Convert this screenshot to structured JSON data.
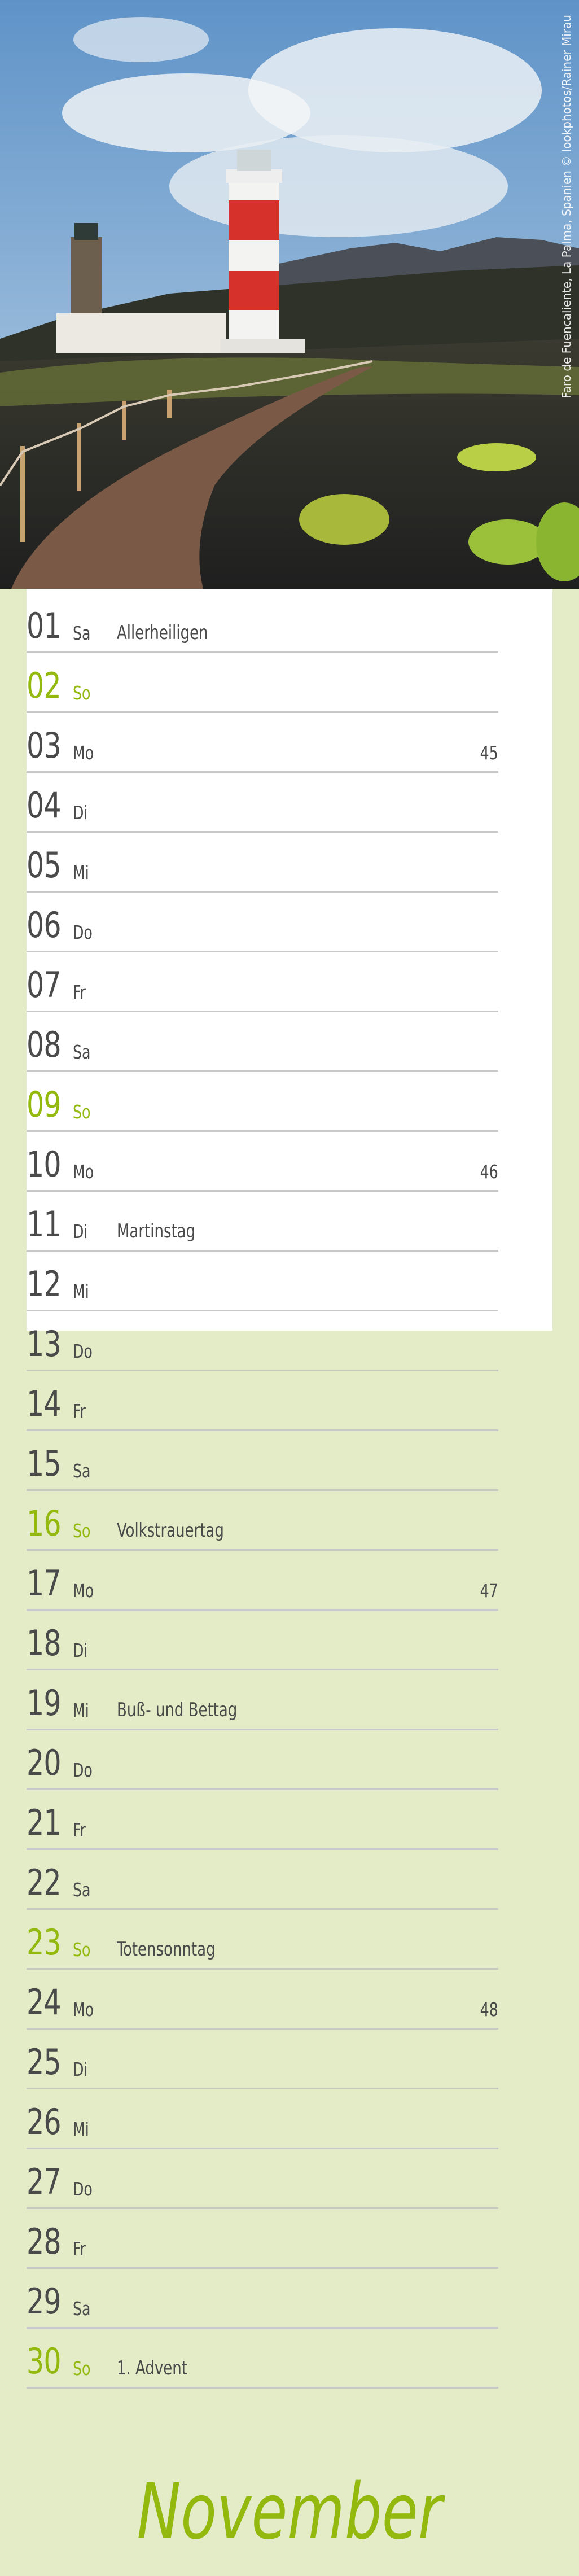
{
  "photo": {
    "credit": "Faro de Fuencaliente, La Palma, Spanien © lookphotos/Rainer Mirau"
  },
  "colors": {
    "accent": "#93b80e",
    "background": "#e3ecc6",
    "text": "#4a4a4a",
    "divider": "#c8c8c8"
  },
  "calendar": {
    "month": "November",
    "days": [
      {
        "day": "01",
        "weekday": "Sa",
        "holiday": "Allerheiligen",
        "sunday": false
      },
      {
        "day": "02",
        "weekday": "So",
        "sunday": true
      },
      {
        "day": "03",
        "weekday": "Mo",
        "week": "45",
        "sunday": false
      },
      {
        "day": "04",
        "weekday": "Di",
        "sunday": false
      },
      {
        "day": "05",
        "weekday": "Mi",
        "sunday": false
      },
      {
        "day": "06",
        "weekday": "Do",
        "sunday": false
      },
      {
        "day": "07",
        "weekday": "Fr",
        "sunday": false
      },
      {
        "day": "08",
        "weekday": "Sa",
        "sunday": false
      },
      {
        "day": "09",
        "weekday": "So",
        "sunday": true
      },
      {
        "day": "10",
        "weekday": "Mo",
        "week": "46",
        "sunday": false
      },
      {
        "day": "11",
        "weekday": "Di",
        "holiday": "Martinstag",
        "sunday": false
      },
      {
        "day": "12",
        "weekday": "Mi",
        "sunday": false
      },
      {
        "day": "13",
        "weekday": "Do",
        "sunday": false
      },
      {
        "day": "14",
        "weekday": "Fr",
        "sunday": false
      },
      {
        "day": "15",
        "weekday": "Sa",
        "sunday": false
      },
      {
        "day": "16",
        "weekday": "So",
        "holiday": "Volkstrauertag",
        "sunday": true
      },
      {
        "day": "17",
        "weekday": "Mo",
        "week": "47",
        "sunday": false
      },
      {
        "day": "18",
        "weekday": "Di",
        "sunday": false
      },
      {
        "day": "19",
        "weekday": "Mi",
        "holiday": "Buß- und Bettag",
        "sunday": false
      },
      {
        "day": "20",
        "weekday": "Do",
        "sunday": false
      },
      {
        "day": "21",
        "weekday": "Fr",
        "sunday": false
      },
      {
        "day": "22",
        "weekday": "Sa",
        "sunday": false
      },
      {
        "day": "23",
        "weekday": "So",
        "holiday": "Totensonntag",
        "sunday": true
      },
      {
        "day": "24",
        "weekday": "Mo",
        "week": "48",
        "sunday": false
      },
      {
        "day": "25",
        "weekday": "Di",
        "sunday": false
      },
      {
        "day": "26",
        "weekday": "Mi",
        "sunday": false
      },
      {
        "day": "27",
        "weekday": "Do",
        "sunday": false
      },
      {
        "day": "28",
        "weekday": "Fr",
        "sunday": false
      },
      {
        "day": "29",
        "weekday": "Sa",
        "sunday": false
      },
      {
        "day": "30",
        "weekday": "So",
        "holiday": "1. Advent",
        "sunday": true
      }
    ]
  }
}
